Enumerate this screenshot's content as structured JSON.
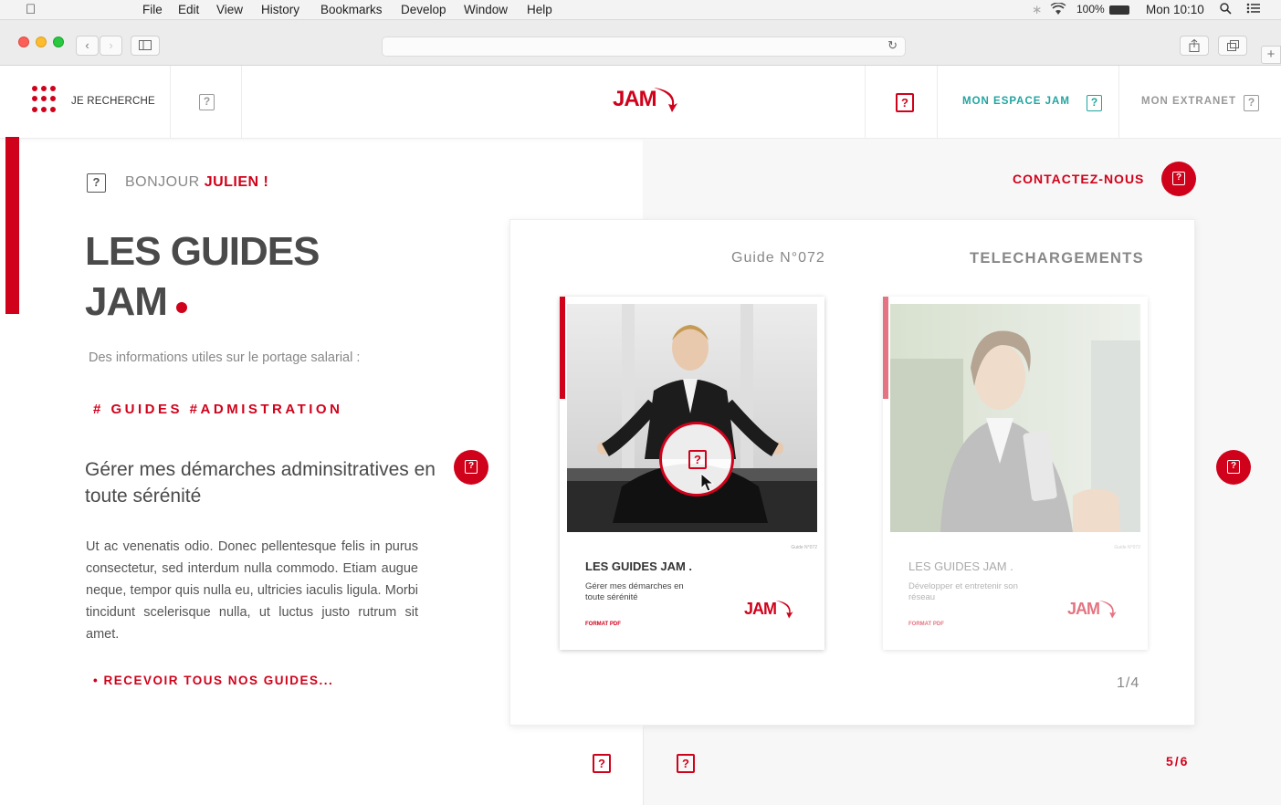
{
  "menubar": {
    "items": [
      "File",
      "Edit",
      "View",
      "History",
      "Bookmarks",
      "Develop",
      "Window",
      "Help"
    ],
    "battery": "100%",
    "clock": "Mon 10:10"
  },
  "header": {
    "search_label": "JE RECHERCHE",
    "logo": "JAM",
    "espace_label": "MON ESPACE JAM",
    "extranet_label": "MON EXTRANET"
  },
  "left": {
    "greeting_prefix": "BONJOUR",
    "greeting_name": "JULIEN !",
    "title_line1": "LES GUIDES",
    "title_line2": "JAM",
    "intro": "Des informations utiles sur le portage salarial :",
    "tags": "# GUIDES #ADMISTRATION",
    "subtitle": "Gérer mes démarches adminsitratives en toute sérénité",
    "body": "Ut ac venenatis odio. Donec pellentesque felis in purus consectetur, sed interdum nulla commodo. Etiam augue neque, tempor quis nulla eu, ultricies iaculis ligula. Morbi tincidunt scelerisque nulla, ut luctus justo rutrum sit amet.",
    "receive_link": "•  RECEVOIR TOUS NOS GUIDES..."
  },
  "right": {
    "contact": "CONTACTEZ-NOUS",
    "guide_number": "Guide N°072",
    "downloads": "TELECHARGEMENTS",
    "page_indicator": "1/4",
    "pager": "5/6"
  },
  "guides": [
    {
      "title": "LES GUIDES JAM .",
      "subtitle": "Gérer mes démarches en toute sérénité",
      "format": "FORMAT PDF",
      "small": "Guide N°072",
      "logo": "JAM"
    },
    {
      "title": "LES GUIDES JAM .",
      "subtitle": "Développer et entretenir son réseau",
      "format": "FORMAT PDF",
      "small": "Guide N°072",
      "logo": "JAM"
    }
  ],
  "colors": {
    "brand_red": "#d0021b",
    "teal": "#1fa5a0",
    "grey_text": "#888888"
  }
}
